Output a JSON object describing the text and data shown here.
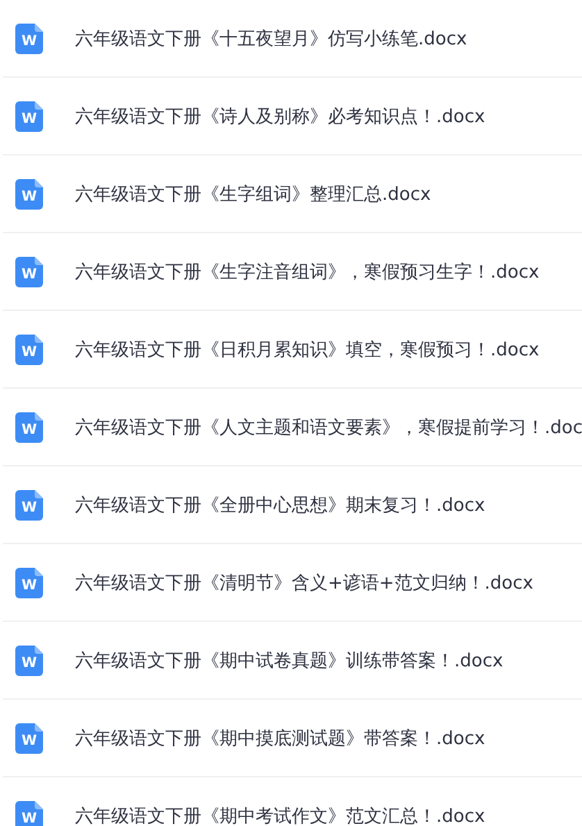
{
  "files": [
    {
      "icon_label": "W",
      "name": "六年级语文下册《十五夜望月》仿写小练笔.docx"
    },
    {
      "icon_label": "W",
      "name": "六年级语文下册《诗人及别称》必考知识点！.docx"
    },
    {
      "icon_label": "W",
      "name": "六年级语文下册《生字组词》整理汇总.docx"
    },
    {
      "icon_label": "W",
      "name": "六年级语文下册《生字注音组词》，寒假预习生字！.docx"
    },
    {
      "icon_label": "W",
      "name": "六年级语文下册《日积月累知识》填空，寒假预习！.docx"
    },
    {
      "icon_label": "W",
      "name": "六年级语文下册《人文主题和语文要素》，寒假提前学习！.doc"
    },
    {
      "icon_label": "W",
      "name": "六年级语文下册《全册中心思想》期末复习！.docx"
    },
    {
      "icon_label": "W",
      "name": "六年级语文下册《清明节》含义+谚语+范文归纳！.docx"
    },
    {
      "icon_label": "W",
      "name": "六年级语文下册《期中试卷真题》训练带答案！.docx"
    },
    {
      "icon_label": "W",
      "name": "六年级语文下册《期中摸底测试题》带答案！.docx"
    },
    {
      "icon_label": "W",
      "name": "六年级语文下册《期中考试作文》范文汇总！.docx"
    }
  ]
}
